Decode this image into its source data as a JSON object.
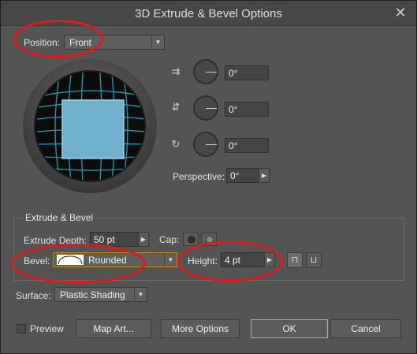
{
  "dialog": {
    "title": "3D Extrude & Bevel Options",
    "close_glyph": "✕"
  },
  "position": {
    "label": "Position:",
    "value": "Front"
  },
  "rotation": {
    "x": {
      "value": "0°"
    },
    "y": {
      "value": "0°"
    },
    "z": {
      "value": "0°"
    },
    "perspective_label": "Perspective:",
    "perspective_value": "0°"
  },
  "extrude_bevel": {
    "group_title": "Extrude & Bevel",
    "depth_label": "Extrude Depth:",
    "depth_value": "50 pt",
    "cap_label": "Cap:",
    "bevel_label": "Bevel:",
    "bevel_value": "Rounded",
    "height_label": "Height:",
    "height_value": "4 pt"
  },
  "surface": {
    "label": "Surface:",
    "value": "Plastic Shading"
  },
  "footer": {
    "preview_label": "Preview",
    "map_art": "Map Art...",
    "more_options": "More Options",
    "ok": "OK",
    "cancel": "Cancel"
  },
  "colors": {
    "annotation": "#e0191d",
    "sphere_grid": "#1aa0b8",
    "cube_face": "#6fb0cc"
  }
}
